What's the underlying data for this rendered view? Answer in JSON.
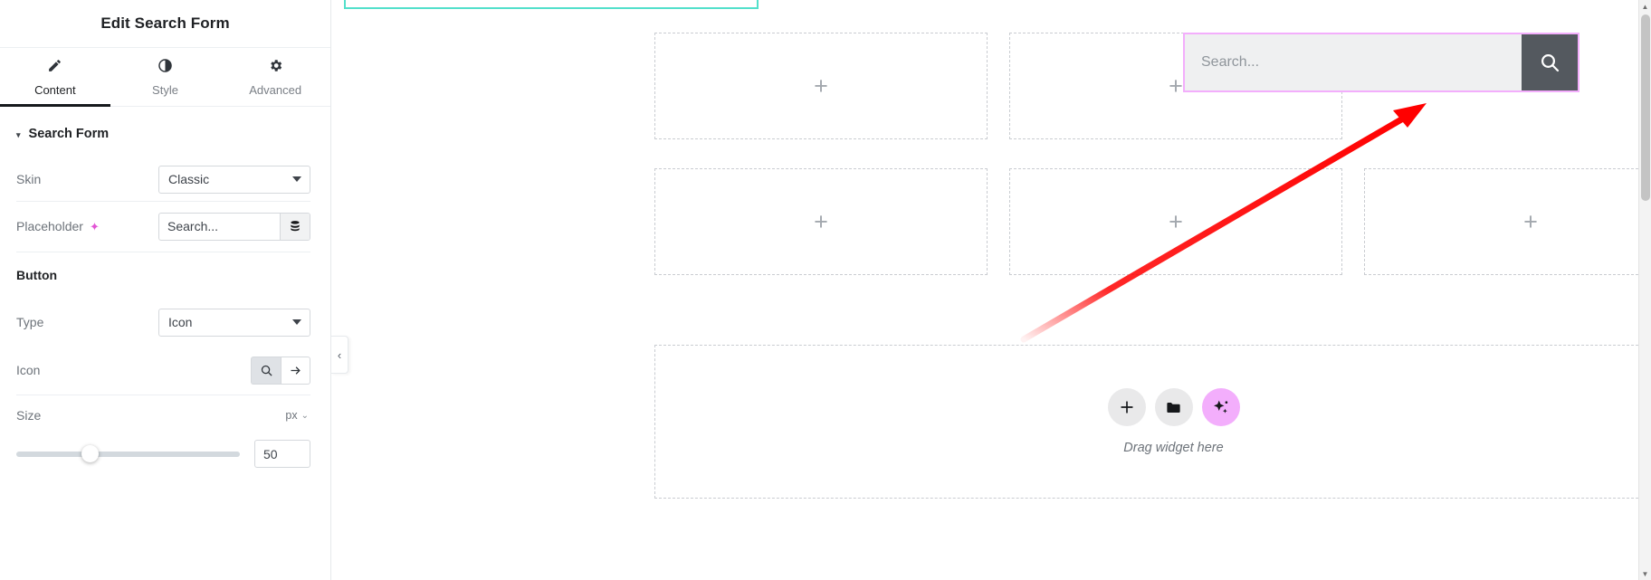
{
  "panel": {
    "title": "Edit Search Form",
    "tabs": [
      {
        "label": "Content",
        "icon": "pencil-icon",
        "active": true
      },
      {
        "label": "Style",
        "icon": "contrast-icon",
        "active": false
      },
      {
        "label": "Advanced",
        "icon": "gear-icon",
        "active": false
      }
    ],
    "section": {
      "title": "Search Form",
      "caret": "▾"
    },
    "controls": {
      "skin": {
        "label": "Skin",
        "value": "Classic"
      },
      "placeholder": {
        "label": "Placeholder",
        "ai_icon": "sparkle-icon",
        "value": "Search...",
        "input_placeholder": "Search...",
        "dynamic_tag_icon": "database-icon"
      },
      "button_group_label": "Button",
      "type": {
        "label": "Type",
        "value": "Icon"
      },
      "icon": {
        "label": "Icon",
        "options": [
          "search-icon",
          "arrow-right-icon"
        ],
        "selected_index": 0
      },
      "size": {
        "label": "Size",
        "unit": "px",
        "unit_caret": "⌄",
        "value": "50",
        "slider_percent": 33
      }
    },
    "collapse_tab": {
      "icon": "chevron-left-icon",
      "glyph": "‹"
    }
  },
  "canvas": {
    "empty_cells": [
      {
        "plus": "+"
      },
      {
        "plus": "+"
      },
      {
        "plus": "+"
      },
      {
        "plus": "+"
      },
      {
        "plus": "+"
      }
    ],
    "search_widget": {
      "placeholder": "Search...",
      "button_icon": "search-icon",
      "selected": true,
      "selection_color": "#f3aefc",
      "button_color": "#54595f",
      "field_color": "#eff0f1"
    },
    "highlight_box_color": "#53e0cb",
    "dropzone": {
      "text": "Drag widget here",
      "buttons": [
        {
          "icon": "plus-icon",
          "glyph": "+"
        },
        {
          "icon": "folder-icon",
          "glyph": "▰"
        },
        {
          "icon": "ai-sparkle-icon",
          "glyph": "✦"
        }
      ]
    },
    "annotation": {
      "type": "arrow",
      "color": "#ff0000"
    }
  },
  "scrollbar": {
    "up": "▲",
    "down": "▼"
  }
}
